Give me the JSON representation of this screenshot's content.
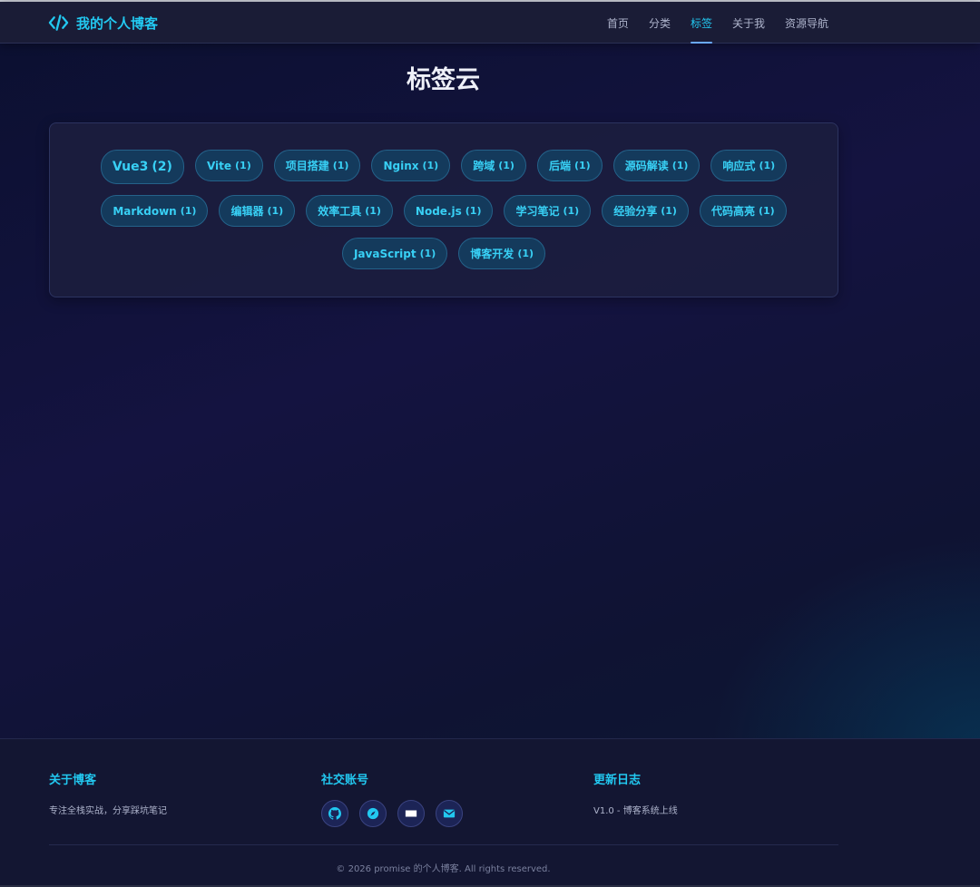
{
  "header": {
    "logo_text": "我的个人博客",
    "nav": [
      {
        "label": "首页",
        "active": false
      },
      {
        "label": "分类",
        "active": false
      },
      {
        "label": "标签",
        "active": true
      },
      {
        "label": "关于我",
        "active": false
      },
      {
        "label": "资源导航",
        "active": false
      }
    ]
  },
  "page": {
    "title": "标签云"
  },
  "tags": [
    {
      "name": "Vue3",
      "count": "(2)"
    },
    {
      "name": "Vite",
      "count": "(1)"
    },
    {
      "name": "项目搭建",
      "count": "(1)"
    },
    {
      "name": "Nginx",
      "count": "(1)"
    },
    {
      "name": "跨域",
      "count": "(1)"
    },
    {
      "name": "后端",
      "count": "(1)"
    },
    {
      "name": "源码解读",
      "count": "(1)"
    },
    {
      "name": "响应式",
      "count": "(1)"
    },
    {
      "name": "Markdown",
      "count": "(1)"
    },
    {
      "name": "编辑器",
      "count": "(1)"
    },
    {
      "name": "效率工具",
      "count": "(1)"
    },
    {
      "name": "Node.js",
      "count": "(1)"
    },
    {
      "name": "学习笔记",
      "count": "(1)"
    },
    {
      "name": "经验分享",
      "count": "(1)"
    },
    {
      "name": "代码高亮",
      "count": "(1)"
    },
    {
      "name": "JavaScript",
      "count": "(1)"
    },
    {
      "name": "博客开发",
      "count": "(1)"
    }
  ],
  "footer": {
    "about": {
      "title": "关于博客",
      "text": "专注全栈实战，分享踩坑笔记"
    },
    "social": {
      "title": "社交账号",
      "icons": [
        "github-icon",
        "compass-icon",
        "card-icon",
        "mail-icon"
      ]
    },
    "changelog": {
      "title": "更新日志",
      "text": "V1.0 - 博客系统上线"
    },
    "copyright": "© 2026 promise 的个人博客. All rights reserved."
  },
  "colors": {
    "accent": "#22c8f0",
    "tag_bg": "#143a5c",
    "header_bg": "#1a1c36",
    "footer_bg": "#131632"
  }
}
